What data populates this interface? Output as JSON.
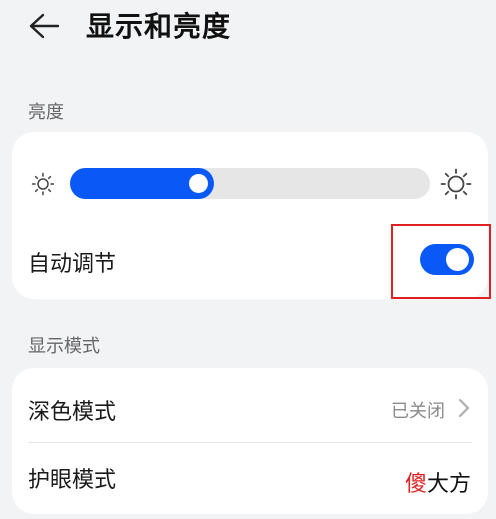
{
  "header": {
    "title": "显示和亮度",
    "back_icon": "arrow-left-icon"
  },
  "brightness": {
    "section_label": "亮度",
    "slider_level_percent": 40,
    "low_icon": "sun-low-icon",
    "high_icon": "sun-high-icon",
    "auto_label": "自动调节",
    "auto_enabled": true
  },
  "display_mode": {
    "section_label": "显示模式",
    "dark_mode_label": "深色模式",
    "dark_mode_value": "已关闭",
    "eye_comfort_label": "护眼模式"
  },
  "watermark": {
    "red_part": "傻",
    "black_part": "大方"
  },
  "colors": {
    "accent": "#0a59f7",
    "highlight": "#e02020",
    "background": "#f1f3f5",
    "card": "#ffffff"
  }
}
